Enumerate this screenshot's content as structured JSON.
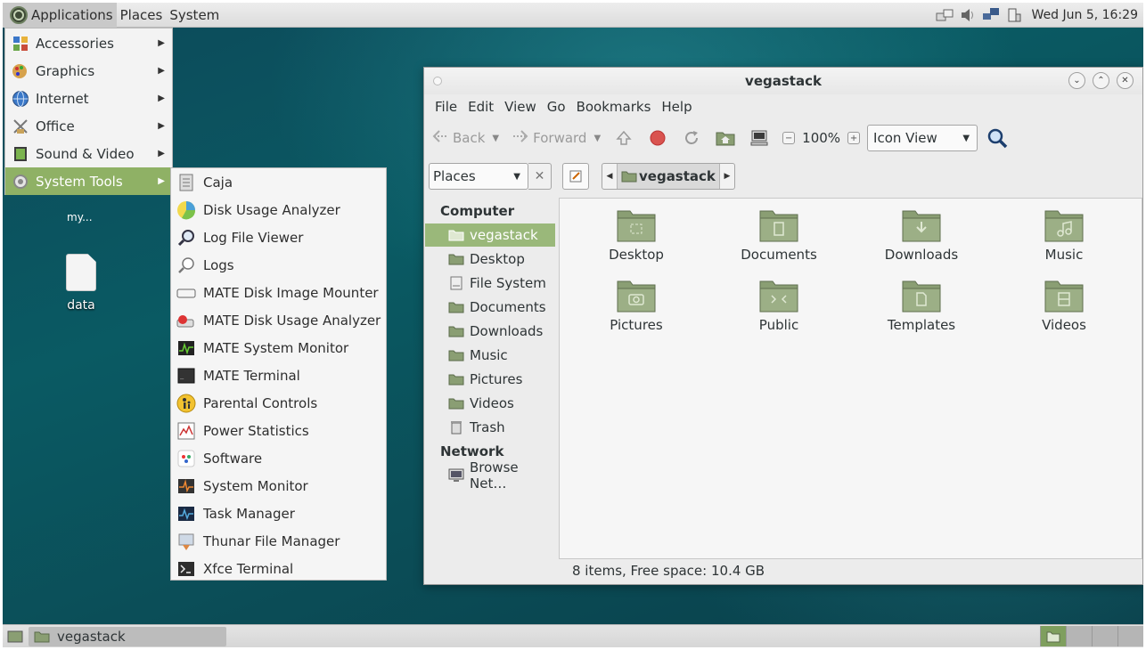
{
  "top_panel": {
    "menus": [
      "Applications",
      "Places",
      "System"
    ],
    "clock": "Wed Jun  5, 16:29"
  },
  "app_menu": {
    "items": [
      {
        "label": "Accessories",
        "icon": "accessories-icon"
      },
      {
        "label": "Graphics",
        "icon": "graphics-icon"
      },
      {
        "label": "Internet",
        "icon": "internet-icon"
      },
      {
        "label": "Office",
        "icon": "office-icon"
      },
      {
        "label": "Sound & Video",
        "icon": "sound-video-icon"
      },
      {
        "label": "System Tools",
        "icon": "system-tools-icon"
      }
    ]
  },
  "system_tools_menu": {
    "items": [
      {
        "label": "Caja"
      },
      {
        "label": "Disk Usage Analyzer"
      },
      {
        "label": "Log File Viewer"
      },
      {
        "label": "Logs"
      },
      {
        "label": "MATE Disk Image Mounter"
      },
      {
        "label": "MATE Disk Usage Analyzer"
      },
      {
        "label": "MATE System Monitor"
      },
      {
        "label": "MATE Terminal"
      },
      {
        "label": "Parental Controls"
      },
      {
        "label": "Power Statistics"
      },
      {
        "label": "Software"
      },
      {
        "label": "System Monitor"
      },
      {
        "label": "Task Manager"
      },
      {
        "label": "Thunar File Manager"
      },
      {
        "label": "Xfce Terminal"
      }
    ]
  },
  "desktop": {
    "icons": [
      {
        "label": "data"
      }
    ],
    "partial_label": "my..."
  },
  "window": {
    "title": "vegastack",
    "menubar": [
      "File",
      "Edit",
      "View",
      "Go",
      "Bookmarks",
      "Help"
    ],
    "toolbar": {
      "back": "Back",
      "forward": "Forward",
      "zoom": "100%",
      "view_mode": "Icon View"
    },
    "location": {
      "places_label": "Places",
      "current_crumb": "vegastack"
    },
    "sidebar": {
      "computer_heading": "Computer",
      "computer_items": [
        "vegastack",
        "Desktop",
        "File System",
        "Documents",
        "Downloads",
        "Music",
        "Pictures",
        "Videos",
        "Trash"
      ],
      "network_heading": "Network",
      "network_items": [
        "Browse Net…"
      ]
    },
    "folders": [
      "Desktop",
      "Documents",
      "Downloads",
      "Music",
      "Pictures",
      "Public",
      "Templates",
      "Videos"
    ],
    "status": "8 items, Free space: 10.4 GB"
  },
  "bottom_panel": {
    "task_label": "vegastack"
  },
  "colors": {
    "accent": "#8fb165",
    "folder": "#8a9e73"
  }
}
